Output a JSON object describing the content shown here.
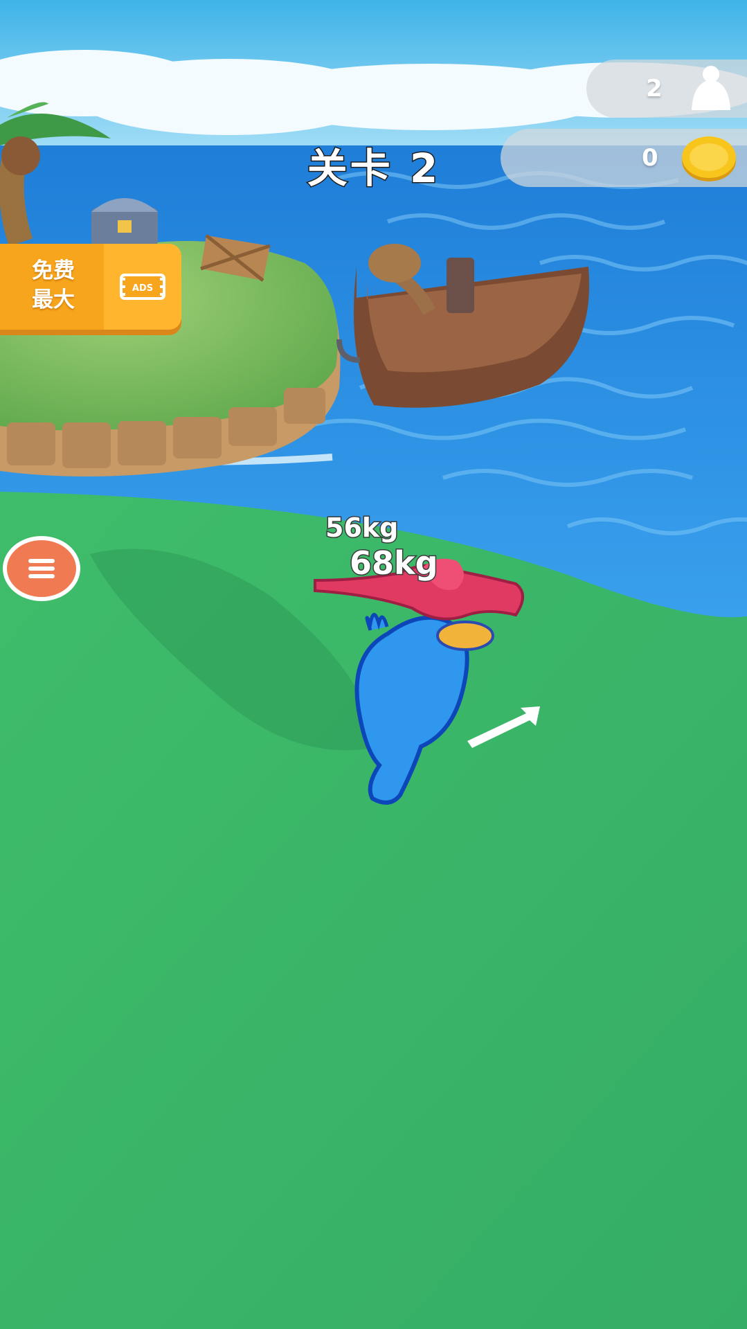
{
  "hud": {
    "level_label": "关卡 2",
    "crowd_count": "2",
    "coin_count": "0"
  },
  "free_max_button": {
    "label_line1": "免费",
    "label_line2": "最大",
    "badge_text": "ADS"
  },
  "player": {
    "weight_label": "68kg"
  },
  "opponent": {
    "weight_label": "56kg"
  },
  "colors": {
    "sky": "#6cc7ee",
    "sea": "#2f8ee0",
    "grass": "#3ab46a",
    "player": "#2f97ee",
    "opponent": "#e03a62",
    "button_orange": "#f7a51c",
    "menu_button": "#f07b52",
    "coin": "#f7c51c"
  },
  "icons": {
    "crowd": "person-silhouette-icon",
    "coin": "gold-coin-icon",
    "menu": "hamburger-menu-icon",
    "ads": "video-ad-icon",
    "direction": "arrow-up-right-icon"
  }
}
